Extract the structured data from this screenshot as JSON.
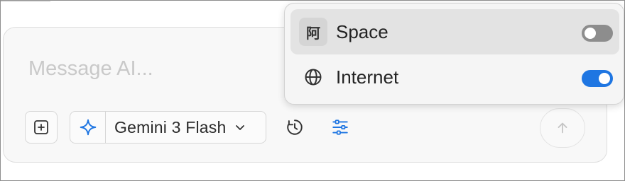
{
  "composer": {
    "placeholder": "Message AI...",
    "model_label": "Gemini 3 Flash"
  },
  "menu": {
    "items": [
      {
        "label": "Space",
        "icon_glyph": "阿",
        "icon": "space-icon",
        "enabled": false
      },
      {
        "label": "Internet",
        "icon": "globe-icon",
        "enabled": true
      }
    ]
  },
  "colors": {
    "accent": "#1f76e2",
    "toggle_off": "#8d8d8d",
    "menu_highlight": "#e3e3e3"
  }
}
